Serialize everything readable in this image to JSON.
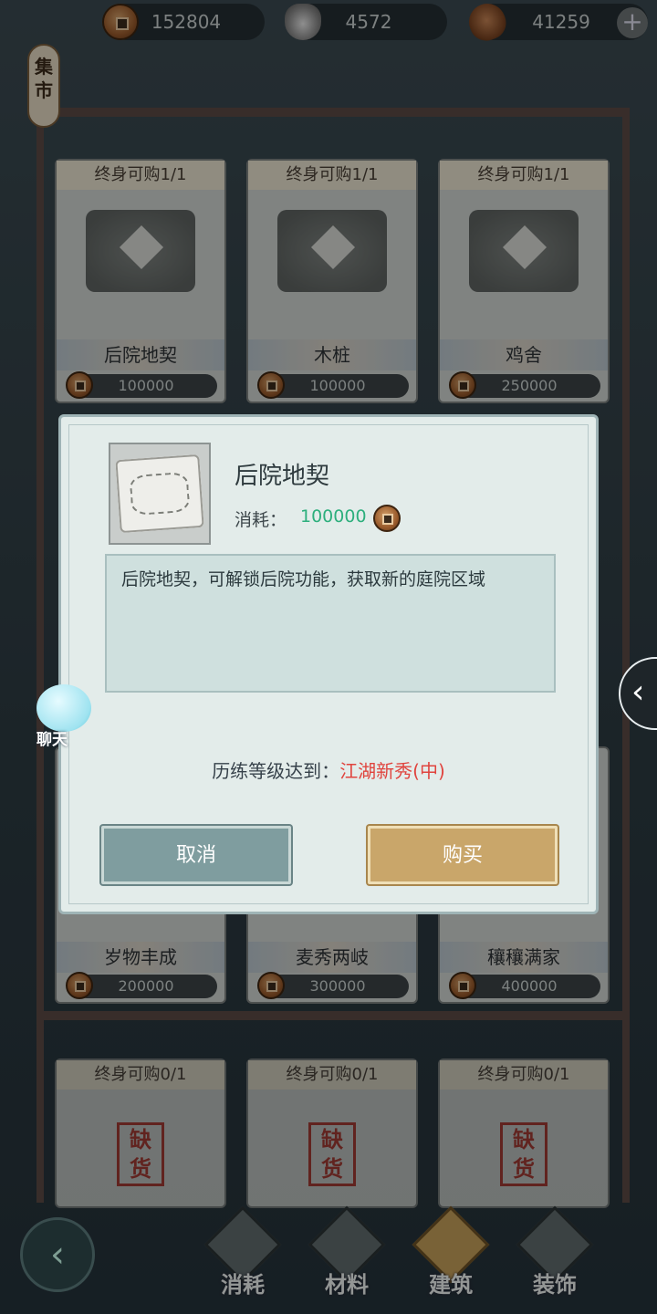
{
  "currency": {
    "coins": "152804",
    "silver": "4572",
    "copper": "41259",
    "add_icon": "plus-icon"
  },
  "tag": {
    "label": "集市"
  },
  "shop_cards": [
    {
      "limit": "终身可购1/1",
      "name": "后院地契",
      "price": "100000"
    },
    {
      "limit": "终身可购1/1",
      "name": "木桩",
      "price": "100000"
    },
    {
      "limit": "终身可购1/1",
      "name": "鸡舍",
      "price": "250000"
    },
    {
      "limit": "",
      "name": "岁物丰成",
      "price": "200000"
    },
    {
      "limit": "",
      "name": "麦秀两岐",
      "price": "300000"
    },
    {
      "limit": "",
      "name": "穰穰满家",
      "price": "400000"
    },
    {
      "limit": "终身可购0/1",
      "name": "",
      "price": "",
      "stamp": "缺货"
    },
    {
      "limit": "终身可购0/1",
      "name": "",
      "price": "",
      "stamp": "缺货"
    },
    {
      "limit": "终身可购0/1",
      "name": "",
      "price": "",
      "stamp": "缺货"
    }
  ],
  "modal": {
    "item_name": "后院地契",
    "cost_label": "消耗：",
    "cost_value": "100000",
    "description": "后院地契，可解锁后院功能，获取新的庭院区域",
    "requirement_label": "历练等级达到：",
    "requirement_value": "江湖新秀(中)",
    "cancel_label": "取消",
    "buy_label": "购买"
  },
  "chat": {
    "label": "聊天"
  },
  "nav": [
    {
      "label": "消耗",
      "active": false
    },
    {
      "label": "材料",
      "active": false
    },
    {
      "label": "建筑",
      "active": true
    },
    {
      "label": "装饰",
      "active": false
    }
  ],
  "colors": {
    "cost_value": "#2daf7d",
    "requirement_value": "#e0443e",
    "buy_button": "#c9a66a",
    "cancel_button": "#7f9d9f"
  }
}
